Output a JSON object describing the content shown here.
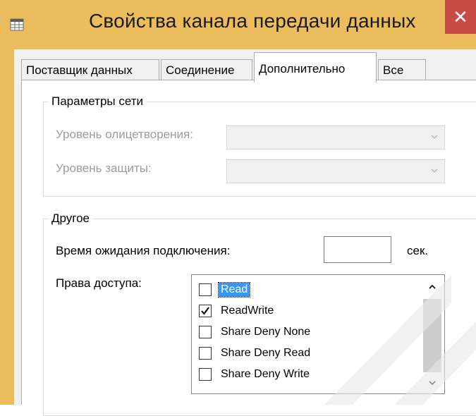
{
  "window": {
    "title": "Свойства канала передачи данных",
    "close_glyph": "✕",
    "app_icon": "table-window-icon",
    "titlebar_color": "#ebbc5b",
    "close_color": "#c84b46"
  },
  "tabs": [
    {
      "label": "Поставщик данных",
      "active": false
    },
    {
      "label": "Соединение",
      "active": false
    },
    {
      "label": "Дополнительно",
      "active": true
    },
    {
      "label": "Все",
      "active": false
    }
  ],
  "network_group": {
    "legend": "Параметры сети",
    "impersonation_label": "Уровень олицетворения:",
    "impersonation_value": "",
    "protection_label": "Уровень защиты:",
    "protection_value": ""
  },
  "other_group": {
    "legend": "Другое",
    "timeout_label": "Время ожидания подключения:",
    "timeout_value": "",
    "timeout_unit": "сек.",
    "access_label": "Права доступа:",
    "access_items": [
      {
        "label": "Read",
        "checked": false,
        "selected": true
      },
      {
        "label": "ReadWrite",
        "checked": true,
        "selected": false
      },
      {
        "label": "Share Deny None",
        "checked": false,
        "selected": false
      },
      {
        "label": "Share Deny Read",
        "checked": false,
        "selected": false
      },
      {
        "label": "Share Deny Write",
        "checked": false,
        "selected": false
      }
    ],
    "scroll_up_glyph": "⌃",
    "scroll_down_glyph": "⌄"
  }
}
